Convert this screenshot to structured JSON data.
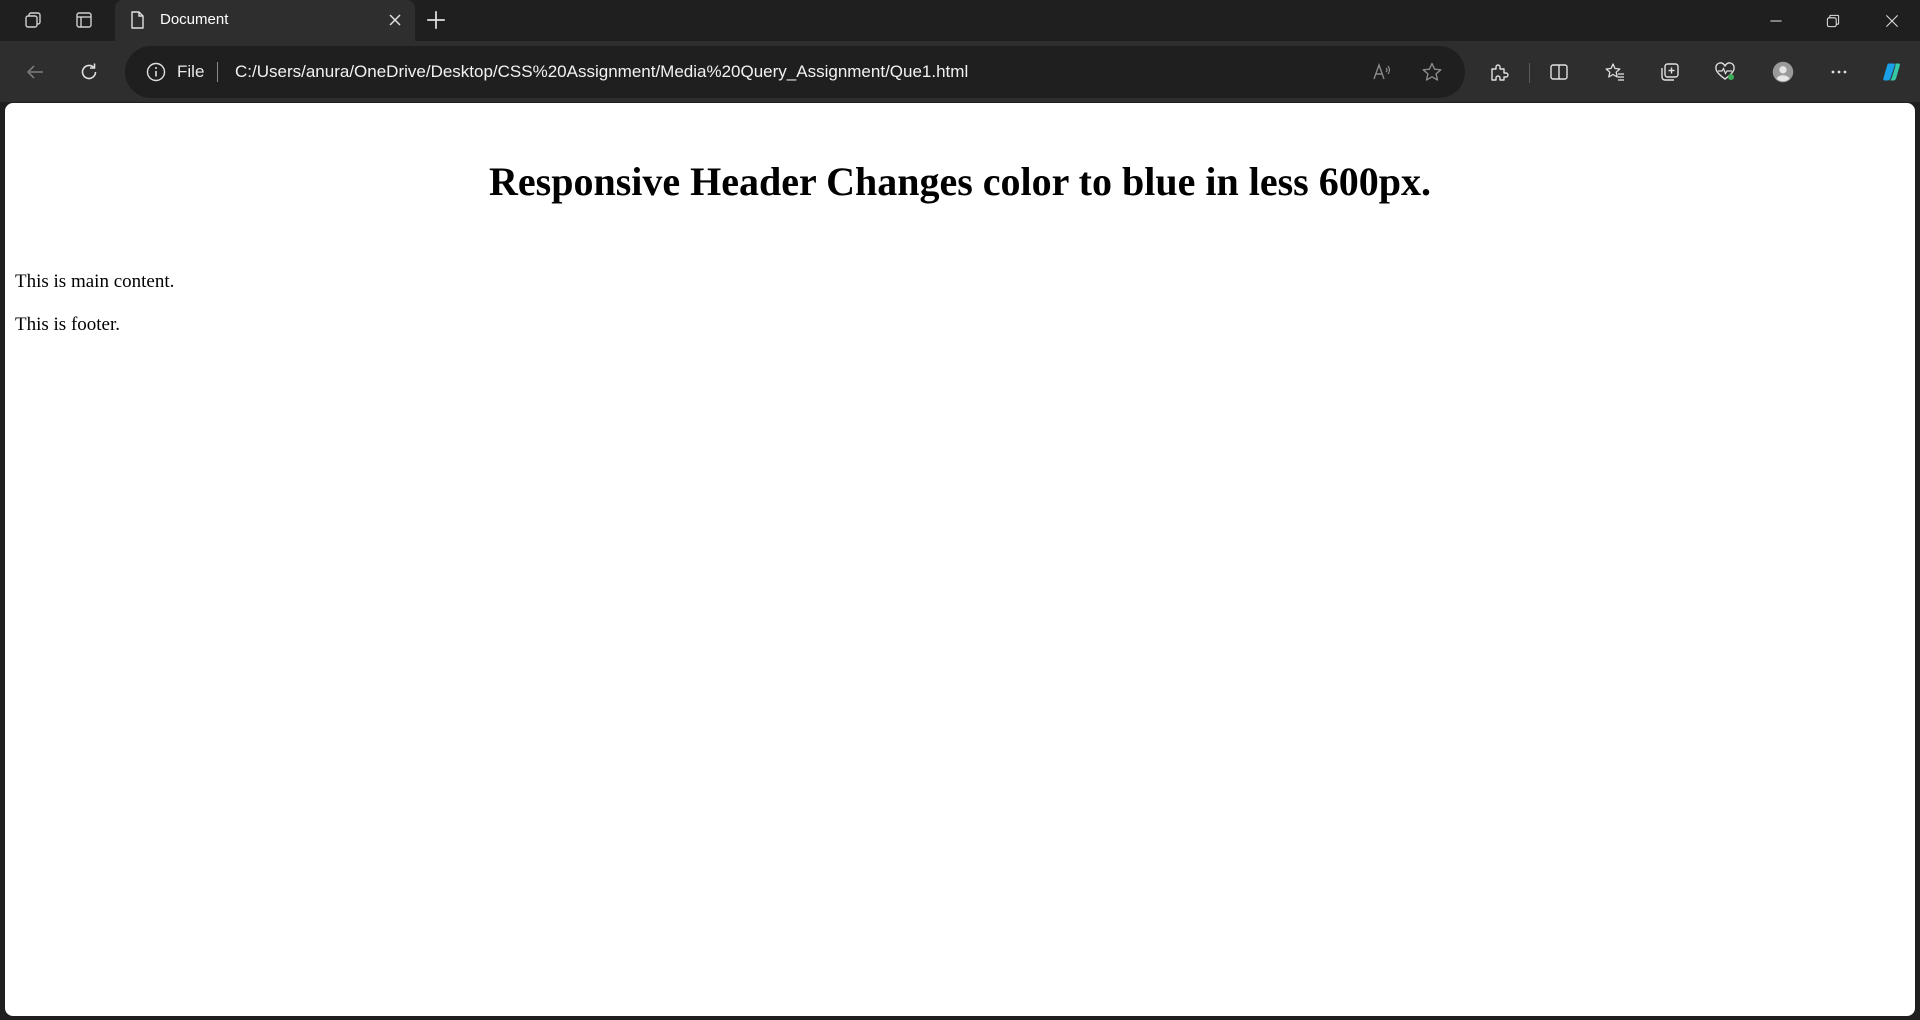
{
  "browser": {
    "tab": {
      "title": "Document"
    },
    "address_bar": {
      "scheme_label": "File",
      "url": "C:/Users/anura/OneDrive/Desktop/CSS%20Assignment/Media%20Query_Assignment/Que1.html"
    }
  },
  "page": {
    "header": "Responsive Header Changes color to blue in less 600px.",
    "main_text": "This is main content.",
    "footer_text": "This is footer."
  },
  "colors": {
    "chrome_dark": "#1f1f1f",
    "toolbar": "#2e2e2e",
    "page_background": "#ffffff",
    "text": "#000000",
    "copilot_accent": "#1aa0e8"
  }
}
